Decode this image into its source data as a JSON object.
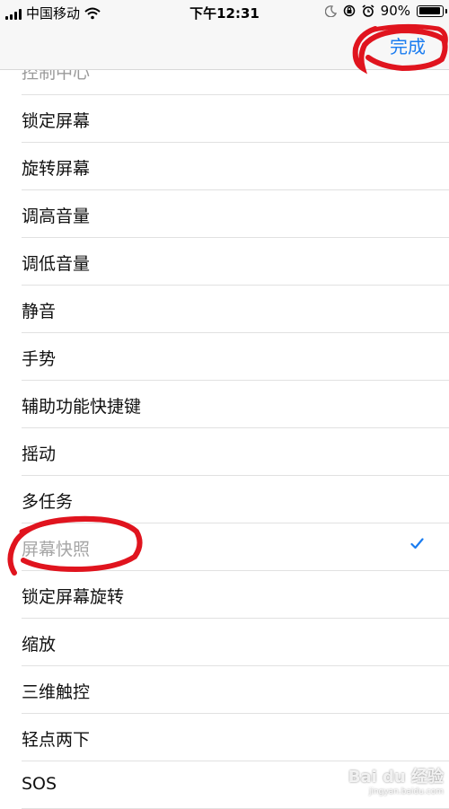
{
  "status": {
    "carrier": "中国移动",
    "time": "下午12:31",
    "battery_percent": "90%",
    "battery_level": 0.9
  },
  "navbar": {
    "done_label": "完成"
  },
  "list": {
    "items": [
      {
        "label": "控制中心",
        "partial": true
      },
      {
        "label": "锁定屏幕"
      },
      {
        "label": "旋转屏幕"
      },
      {
        "label": "调高音量"
      },
      {
        "label": "调低音量"
      },
      {
        "label": "静音"
      },
      {
        "label": "手势"
      },
      {
        "label": "辅助功能快捷键"
      },
      {
        "label": "摇动"
      },
      {
        "label": "多任务"
      },
      {
        "label": "屏幕快照",
        "selected": true
      },
      {
        "label": "锁定屏幕旋转"
      },
      {
        "label": "缩放"
      },
      {
        "label": "三维触控"
      },
      {
        "label": "轻点两下"
      },
      {
        "label": "SOS"
      }
    ]
  },
  "watermark": {
    "text": "Bai du 经验",
    "url": "jingyan.baidu.com"
  },
  "colors": {
    "accent": "#1a7cf0",
    "annotation": "#e0141e"
  }
}
